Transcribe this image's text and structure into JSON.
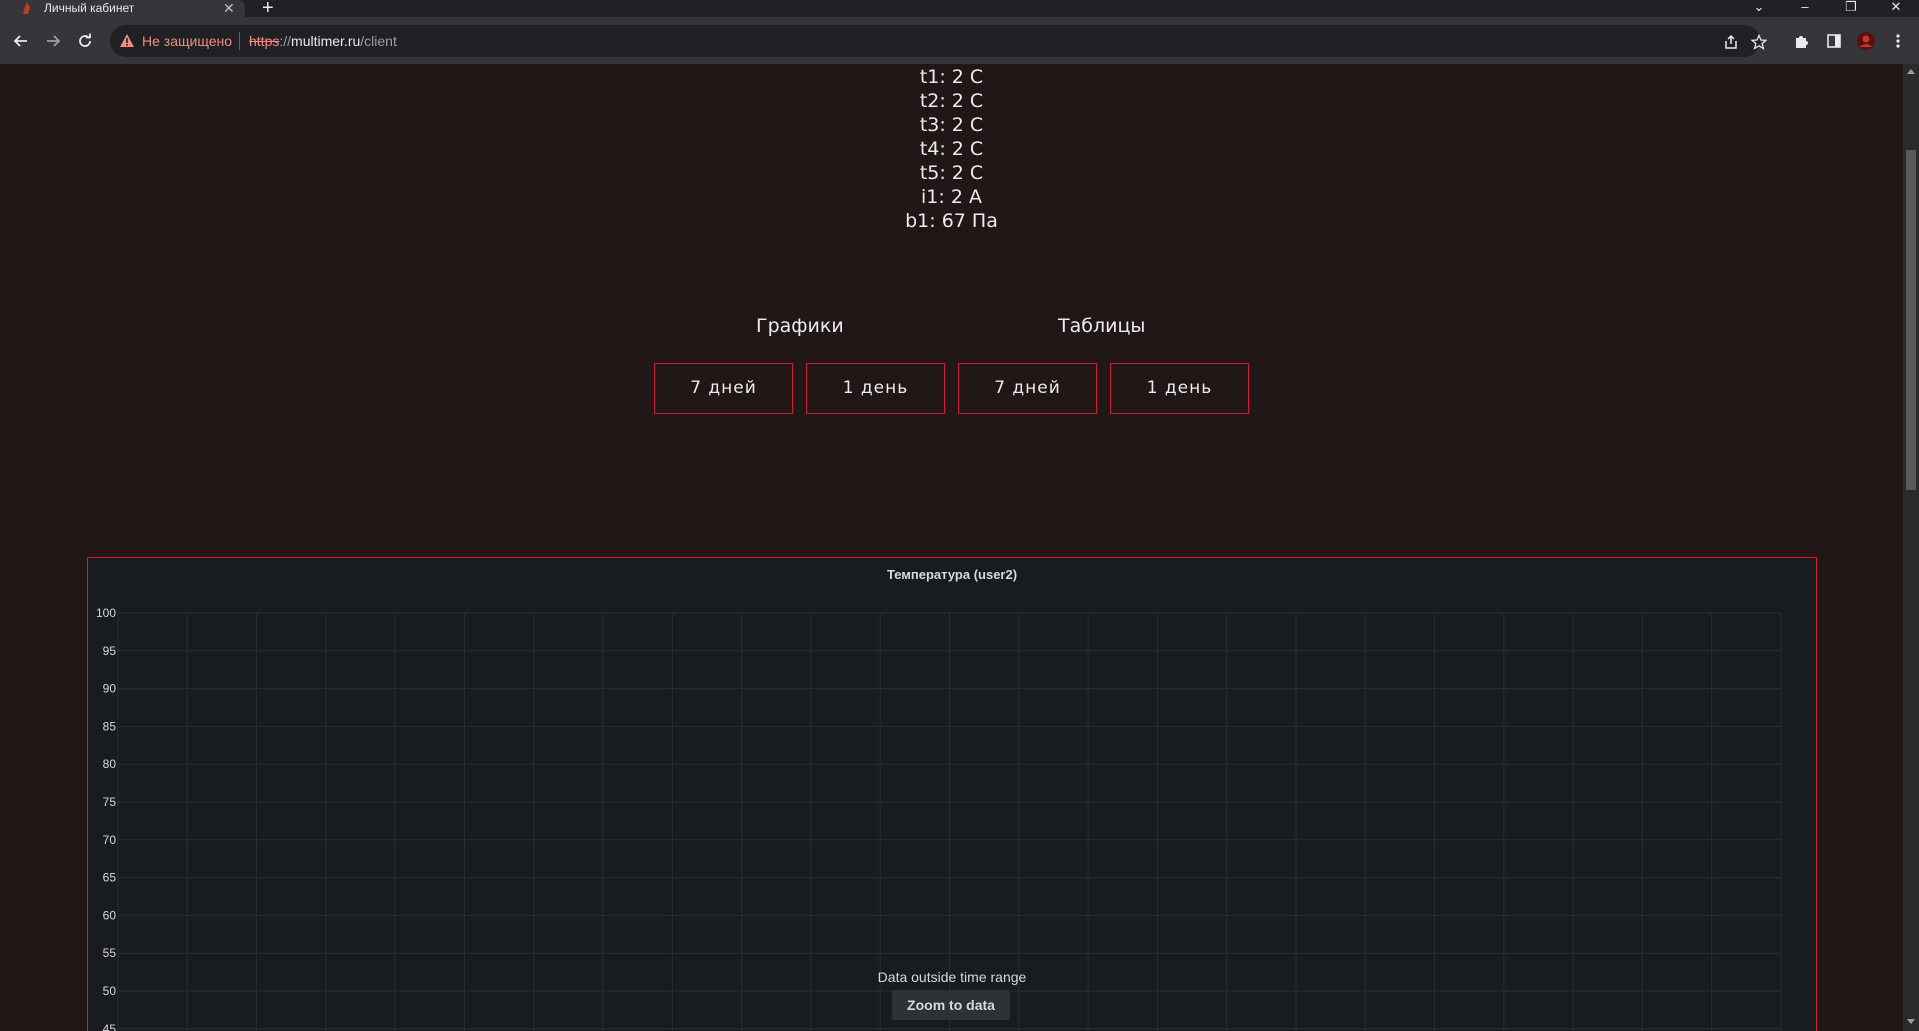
{
  "browser": {
    "tab_title": "Личный кабинет",
    "security_label": "Не защищено",
    "url_scheme": "https",
    "url_sep": "://",
    "url_host": "multimer.ru",
    "url_path": "/client"
  },
  "readings": [
    {
      "text": "t1: 2 C"
    },
    {
      "text": "t2: 2 C"
    },
    {
      "text": "t3: 2 C"
    },
    {
      "text": "t4: 2 C"
    },
    {
      "text": "t5: 2 C"
    },
    {
      "text": "i1: 2 A"
    },
    {
      "text": "b1: 67 Па"
    }
  ],
  "sections": {
    "charts_title": "Графики",
    "tables_title": "Таблицы",
    "charts_7d": "7 дней",
    "charts_1d": "1 день",
    "tables_7d": "7 дней",
    "tables_1d": "1 день"
  },
  "chart_data": {
    "type": "line",
    "title": "Температура (user2)",
    "xlabel": "",
    "ylabel": "",
    "ylim": [
      45,
      100
    ],
    "y_ticks": [
      100,
      95,
      90,
      85,
      80,
      75,
      70,
      65,
      60,
      55,
      50,
      45
    ],
    "series": [],
    "grid": true,
    "message": "Data outside time range",
    "action_label": "Zoom to data"
  },
  "colors": {
    "page_bg": "#201716",
    "accent_border": "#d11b3e",
    "panel_border": "#d21f1f",
    "panel_bg": "#181b1f"
  }
}
